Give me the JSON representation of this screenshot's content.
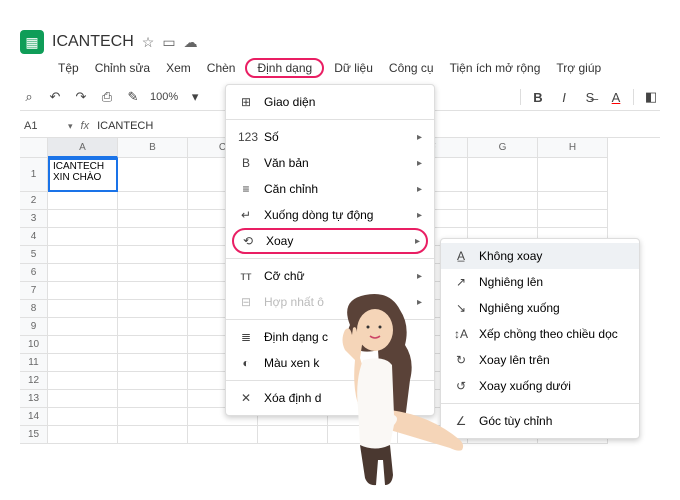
{
  "header": {
    "title": "ICANTECH",
    "logo_glyph": "▦"
  },
  "menu": {
    "items": [
      "Tệp",
      "Chỉnh sửa",
      "Xem",
      "Chèn",
      "Định dạng",
      "Dữ liệu",
      "Công cụ",
      "Tiện ích mở rộng",
      "Trợ giúp"
    ],
    "highlighted_index": 4
  },
  "toolbar": {
    "zoom": "100%"
  },
  "cellref": {
    "ref": "A1",
    "fx": "fx",
    "value": "ICANTECH"
  },
  "sheet": {
    "columns": [
      "A",
      "B",
      "C",
      "D",
      "E",
      "F",
      "G",
      "H"
    ],
    "row_count": 15,
    "selected_col": 0,
    "cells": {
      "a1": "ICANTECH",
      "a1b": "XIN CHÀO"
    }
  },
  "dropdown1": {
    "items": [
      {
        "icon": "⊞",
        "label": "Giao diện",
        "arrow": false,
        "sep_after": true
      },
      {
        "icon": "123",
        "label": "Số",
        "arrow": true
      },
      {
        "icon": "B",
        "label": "Văn bản",
        "arrow": true
      },
      {
        "icon": "≡",
        "label": "Căn chỉnh",
        "arrow": true
      },
      {
        "icon": "↵",
        "label": "Xuống dòng tự động",
        "arrow": true
      },
      {
        "icon": "⟲",
        "label": "Xoay",
        "arrow": true,
        "highlighted": true,
        "sep_after": true
      },
      {
        "icon": "ᴛᴛ",
        "label": "Cỡ chữ",
        "arrow": true
      },
      {
        "icon": "⊟",
        "label": "Hợp nhất ô",
        "arrow": true,
        "disabled": true,
        "sep_after": true
      },
      {
        "icon": "≣",
        "label": "Định dạng c",
        "arrow": false
      },
      {
        "icon": "◐",
        "label": "Màu xen k",
        "arrow": false,
        "sep_after": true
      },
      {
        "icon": "✕",
        "label": "Xóa định d",
        "arrow": false
      }
    ]
  },
  "dropdown2": {
    "items": [
      {
        "icon": "A̲",
        "label": "Không xoay",
        "hover": true
      },
      {
        "icon": "↗",
        "label": "Nghiêng lên"
      },
      {
        "icon": "↘",
        "label": "Nghiêng xuống"
      },
      {
        "icon": "↕A",
        "label": "Xếp chồng theo chiều dọc"
      },
      {
        "icon": "↻",
        "label": "Xoay lên trên"
      },
      {
        "icon": "↺",
        "label": "Xoay xuống dưới"
      },
      {
        "icon": "∠",
        "label": "Góc tùy chỉnh",
        "sep_before": true
      }
    ]
  }
}
